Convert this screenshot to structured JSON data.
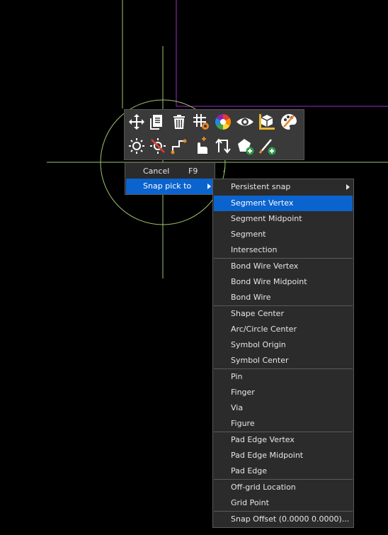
{
  "colors": {
    "crosshair": "#9fc56e",
    "snap_circle": "#9fc56e",
    "outline_purple": "#a02bd1",
    "menu_bg": "#2b2b2b",
    "menu_highlight": "#0b63ce",
    "toolbar_bg": "#3a3a3a"
  },
  "toolbar": {
    "row1_icons": [
      "move-icon",
      "copy-icon",
      "delete-icon",
      "grid-settings-icon",
      "color-wheel-icon",
      "visibility-eye-icon",
      "cube-measure-icon",
      "palette-icon"
    ],
    "row2_icons": [
      "highlight-icon",
      "dehighlight-icon",
      "route-icon",
      "hand-pick-icon",
      "swap-icon",
      "add-shape-icon",
      "add-line-icon"
    ]
  },
  "context_menu": {
    "items": [
      {
        "label": "Cancel",
        "shortcut": "F9"
      },
      {
        "label": "Snap pick to",
        "has_submenu": true,
        "highlighted": true
      }
    ]
  },
  "submenu": {
    "items": [
      {
        "label": "Persistent snap",
        "has_submenu": true
      },
      {
        "label": "Segment Vertex",
        "highlighted": true
      },
      {
        "label": "Segment Midpoint"
      },
      {
        "label": "Segment"
      },
      {
        "label": "Intersection"
      },
      {
        "label": "Bond Wire Vertex"
      },
      {
        "label": "Bond Wire Midpoint"
      },
      {
        "label": "Bond Wire"
      },
      {
        "label": "Shape Center"
      },
      {
        "label": "Arc/Circle Center"
      },
      {
        "label": "Symbol Origin"
      },
      {
        "label": "Symbol Center"
      },
      {
        "label": "Pin"
      },
      {
        "label": "Finger"
      },
      {
        "label": "Via"
      },
      {
        "label": "Figure"
      },
      {
        "label": "Pad Edge Vertex"
      },
      {
        "label": "Pad Edge Midpoint"
      },
      {
        "label": "Pad Edge"
      },
      {
        "label": "Off-grid Location"
      },
      {
        "label": "Grid Point"
      },
      {
        "label": "Snap Offset (0.0000 0.0000)..."
      }
    ]
  }
}
